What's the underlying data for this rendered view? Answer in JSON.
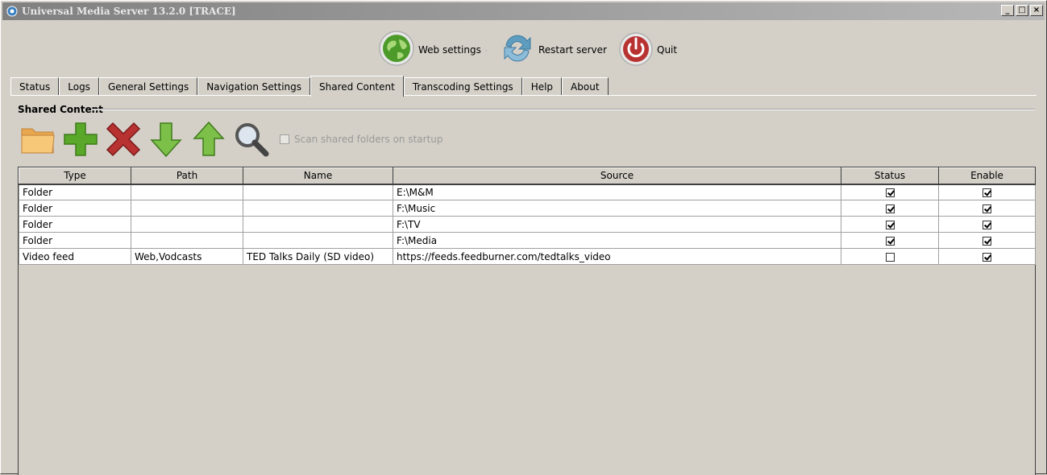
{
  "window": {
    "title": "Universal Media Server 13.2.0  [TRACE]",
    "controls": [
      "_",
      "□",
      "×"
    ]
  },
  "toolbar": {
    "web_settings": "Web settings",
    "restart_server": "Restart server",
    "quit": "Quit",
    "separator": "·"
  },
  "tabs": [
    {
      "label": "Status"
    },
    {
      "label": "Logs"
    },
    {
      "label": "General Settings"
    },
    {
      "label": "Navigation Settings"
    },
    {
      "label": "Shared Content",
      "active": true
    },
    {
      "label": "Transcoding Settings"
    },
    {
      "label": "Help"
    },
    {
      "label": "About"
    }
  ],
  "shared_content": {
    "section_title": "Shared Content",
    "scan_label": "Scan shared folders on startup",
    "scan_checked": false,
    "icons": [
      "folder-icon",
      "add-icon",
      "remove-icon",
      "move-down-icon",
      "move-up-icon",
      "search-icon"
    ]
  },
  "table": {
    "columns": [
      "Type",
      "Path",
      "Name",
      "Source",
      "Status",
      "Enable"
    ],
    "rows": [
      {
        "type": "Folder",
        "path": "",
        "name": "",
        "source": "E:\\M&M",
        "status": true,
        "enable": true
      },
      {
        "type": "Folder",
        "path": "",
        "name": "",
        "source": "F:\\Music",
        "status": true,
        "enable": true
      },
      {
        "type": "Folder",
        "path": "",
        "name": "",
        "source": "F:\\TV",
        "status": true,
        "enable": true
      },
      {
        "type": "Folder",
        "path": "",
        "name": "",
        "source": "F:\\Media",
        "status": true,
        "enable": true
      },
      {
        "type": "Video feed",
        "path": "Web,Vodcasts",
        "name": "TED Talks Daily (SD video)",
        "source": "https://feeds.feedburner.com/tedtalks_video",
        "status": false,
        "enable": true
      }
    ]
  },
  "colors": {
    "window_bg": "#d4d0c8",
    "title_gradient_start": "#808080",
    "green": "#5aa82a",
    "red": "#b83232"
  }
}
